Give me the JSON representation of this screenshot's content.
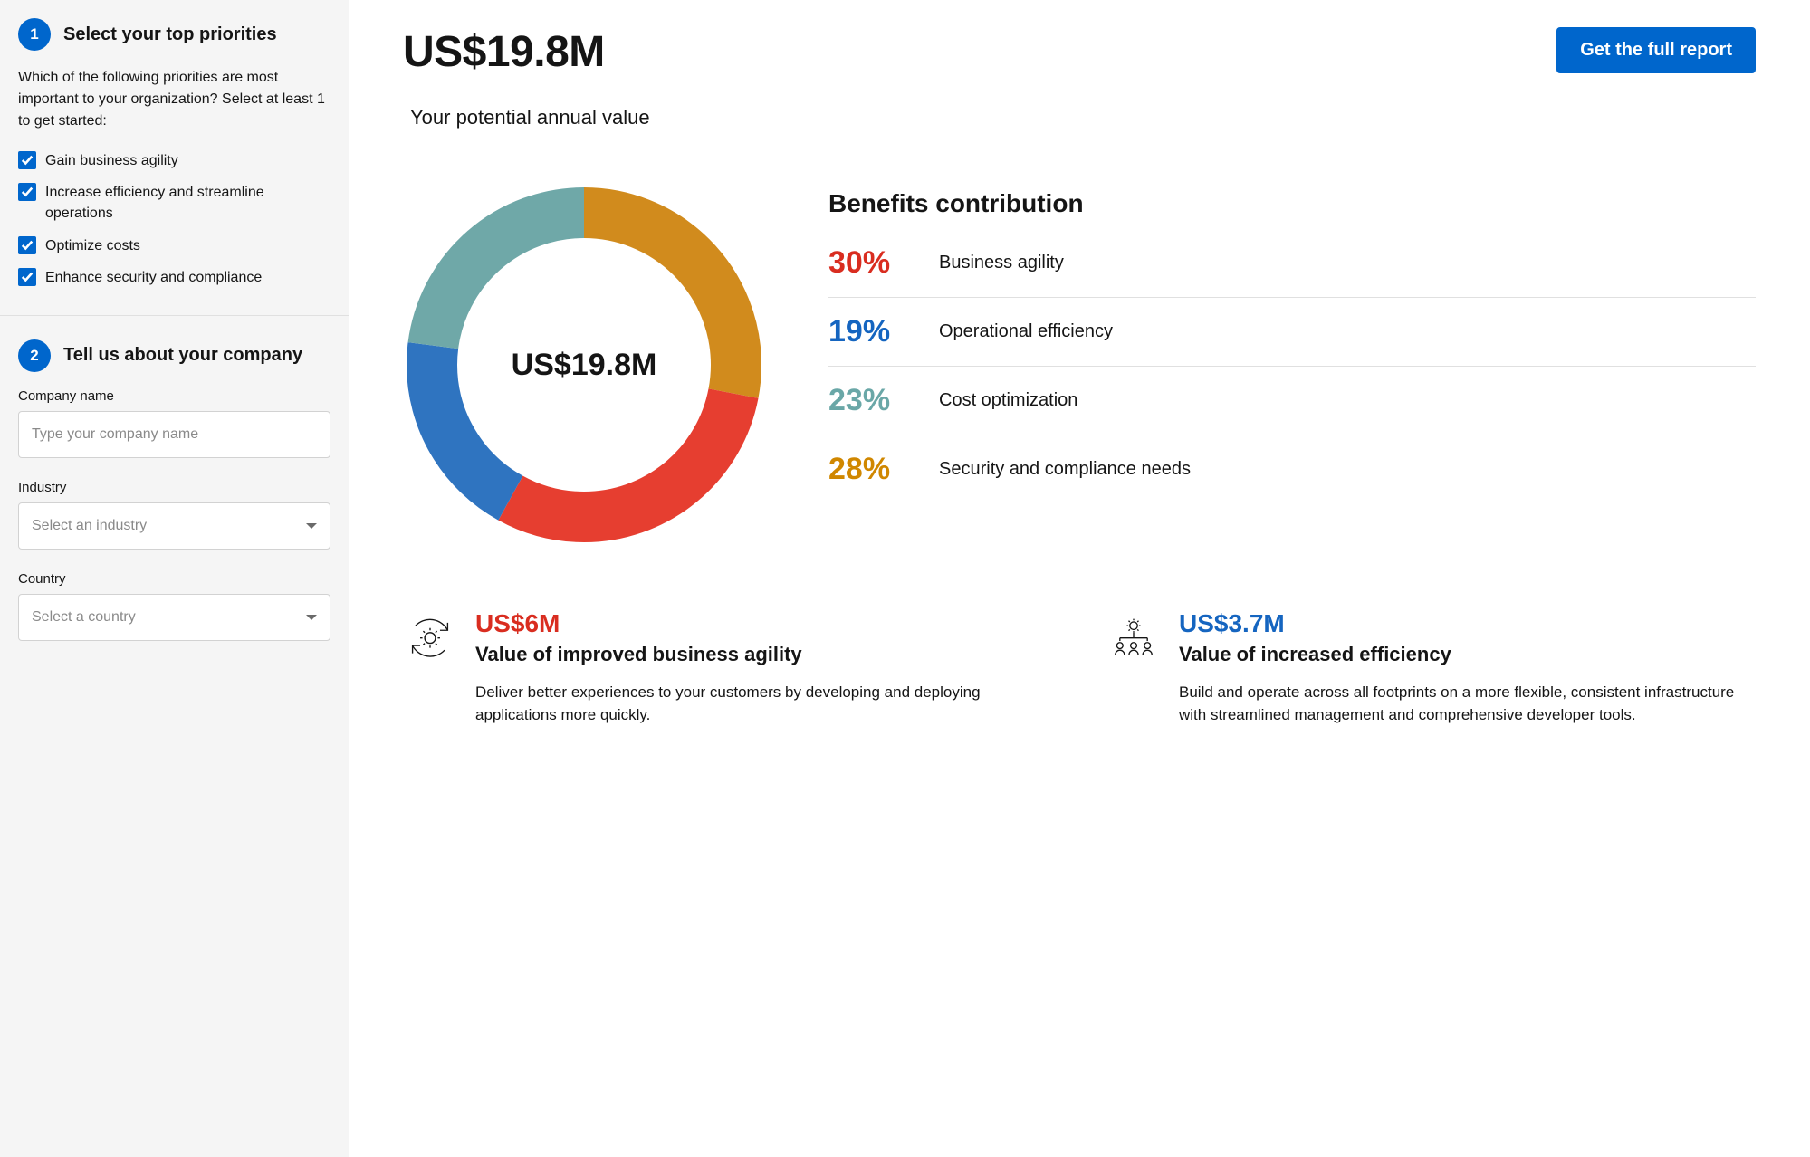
{
  "sidebar": {
    "step1": {
      "number": "1",
      "title": "Select your top priorities",
      "description": "Which of the following priorities are most important to your organization? Select at least 1 to get started:",
      "options": [
        {
          "label": "Gain business agility",
          "checked": true
        },
        {
          "label": "Increase efficiency and streamline operations",
          "checked": true
        },
        {
          "label": "Optimize costs",
          "checked": true
        },
        {
          "label": "Enhance security and compliance",
          "checked": true
        }
      ]
    },
    "step2": {
      "number": "2",
      "title": "Tell us about your company",
      "company_label": "Company name",
      "company_placeholder": "Type your company name",
      "industry_label": "Industry",
      "industry_placeholder": "Select an industry",
      "country_label": "Country",
      "country_placeholder": "Select a country"
    }
  },
  "main": {
    "total_value": "US$19.8M",
    "total_subtitle": "Your potential annual value",
    "report_button": "Get the full report",
    "donut_center": "US$19.8M",
    "benefits_title": "Benefits contribution",
    "benefits": [
      {
        "pct": "30%",
        "label": "Business agility",
        "color": "c-red"
      },
      {
        "pct": "19%",
        "label": "Operational efficiency",
        "color": "c-blue"
      },
      {
        "pct": "23%",
        "label": "Cost optimization",
        "color": "c-teal"
      },
      {
        "pct": "28%",
        "label": "Security and compliance needs",
        "color": "c-orange"
      }
    ],
    "cards": [
      {
        "value": "US$6M",
        "value_color": "c-red",
        "title": "Value of improved business agility",
        "desc": "Deliver better experiences to your customers by developing and deploying applications more quickly.",
        "icon": "gear-refresh"
      },
      {
        "value": "US$3.7M",
        "value_color": "c-blue",
        "title": "Value of increased efficiency",
        "desc": "Build and operate across all footprints on a more flexible, consistent infrastructure with streamlined management and comprehensive developer tools.",
        "icon": "gear-people"
      }
    ]
  },
  "chart_data": {
    "type": "pie",
    "title": "Benefits contribution",
    "center_value": "US$19.8M",
    "series": [
      {
        "name": "Business agility",
        "value": 30,
        "color": "#e63e30"
      },
      {
        "name": "Operational efficiency",
        "value": 19,
        "color": "#2f74c0"
      },
      {
        "name": "Cost optimization",
        "value": 23,
        "color": "#6fa8a8"
      },
      {
        "name": "Security and compliance needs",
        "value": 28,
        "color": "#d18b1d"
      }
    ]
  }
}
